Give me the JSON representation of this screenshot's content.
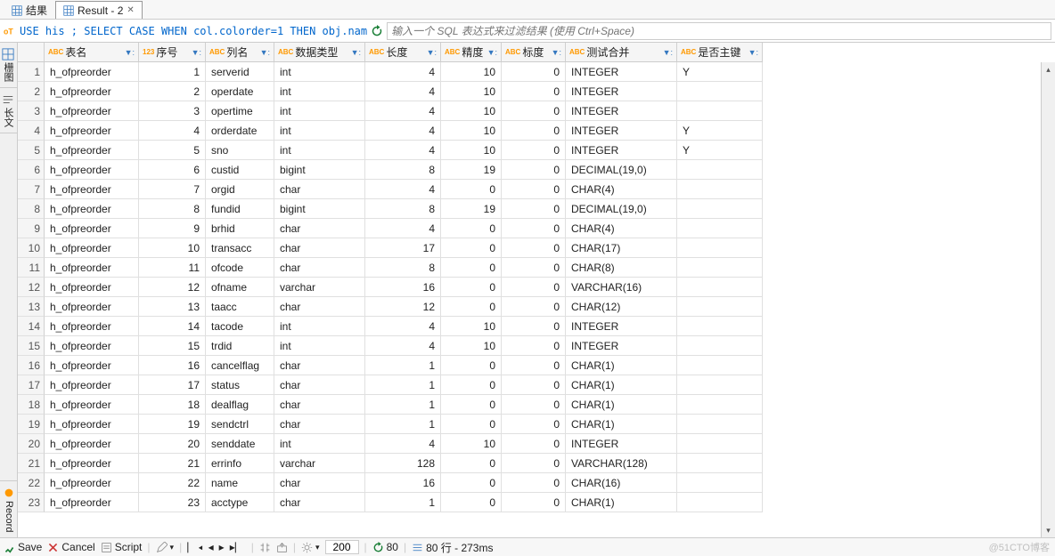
{
  "tabs": {
    "result_cn": "结果",
    "result_en": "Result - 2"
  },
  "toolbar": {
    "sql": "USE his ; SELECT CASE WHEN col.colorder=1 THEN obj.nam",
    "filter_placeholder": "输入一个 SQL 表达式来过滤结果 (使用 Ctrl+Space)"
  },
  "sidetabs": {
    "grid": "栅图",
    "text": "长文"
  },
  "headers": {
    "table": "表名",
    "ord": "序号",
    "col": "列名",
    "dtype": "数据类型",
    "len": "长度",
    "prec": "精度",
    "scale": "标度",
    "test": "测试合并",
    "pk": "是否主键"
  },
  "chart_data": {
    "type": "table",
    "columns": [
      "表名",
      "序号",
      "列名",
      "数据类型",
      "长度",
      "精度",
      "标度",
      "测试合并",
      "是否主键"
    ],
    "rows": [
      [
        "h_ofpreorder",
        1,
        "serverid",
        "int",
        4,
        10,
        0,
        "INTEGER",
        "Y"
      ],
      [
        "h_ofpreorder",
        2,
        "operdate",
        "int",
        4,
        10,
        0,
        "INTEGER",
        ""
      ],
      [
        "h_ofpreorder",
        3,
        "opertime",
        "int",
        4,
        10,
        0,
        "INTEGER",
        ""
      ],
      [
        "h_ofpreorder",
        4,
        "orderdate",
        "int",
        4,
        10,
        0,
        "INTEGER",
        "Y"
      ],
      [
        "h_ofpreorder",
        5,
        "sno",
        "int",
        4,
        10,
        0,
        "INTEGER",
        "Y"
      ],
      [
        "h_ofpreorder",
        6,
        "custid",
        "bigint",
        8,
        19,
        0,
        "DECIMAL(19,0)",
        ""
      ],
      [
        "h_ofpreorder",
        7,
        "orgid",
        "char",
        4,
        0,
        0,
        "CHAR(4)",
        ""
      ],
      [
        "h_ofpreorder",
        8,
        "fundid",
        "bigint",
        8,
        19,
        0,
        "DECIMAL(19,0)",
        ""
      ],
      [
        "h_ofpreorder",
        9,
        "brhid",
        "char",
        4,
        0,
        0,
        "CHAR(4)",
        ""
      ],
      [
        "h_ofpreorder",
        10,
        "transacc",
        "char",
        17,
        0,
        0,
        "CHAR(17)",
        ""
      ],
      [
        "h_ofpreorder",
        11,
        "ofcode",
        "char",
        8,
        0,
        0,
        "CHAR(8)",
        ""
      ],
      [
        "h_ofpreorder",
        12,
        "ofname",
        "varchar",
        16,
        0,
        0,
        "VARCHAR(16)",
        ""
      ],
      [
        "h_ofpreorder",
        13,
        "taacc",
        "char",
        12,
        0,
        0,
        "CHAR(12)",
        ""
      ],
      [
        "h_ofpreorder",
        14,
        "tacode",
        "int",
        4,
        10,
        0,
        "INTEGER",
        ""
      ],
      [
        "h_ofpreorder",
        15,
        "trdid",
        "int",
        4,
        10,
        0,
        "INTEGER",
        ""
      ],
      [
        "h_ofpreorder",
        16,
        "cancelflag",
        "char",
        1,
        0,
        0,
        "CHAR(1)",
        ""
      ],
      [
        "h_ofpreorder",
        17,
        "status",
        "char",
        1,
        0,
        0,
        "CHAR(1)",
        ""
      ],
      [
        "h_ofpreorder",
        18,
        "dealflag",
        "char",
        1,
        0,
        0,
        "CHAR(1)",
        ""
      ],
      [
        "h_ofpreorder",
        19,
        "sendctrl",
        "char",
        1,
        0,
        0,
        "CHAR(1)",
        ""
      ],
      [
        "h_ofpreorder",
        20,
        "senddate",
        "int",
        4,
        10,
        0,
        "INTEGER",
        ""
      ],
      [
        "h_ofpreorder",
        21,
        "errinfo",
        "varchar",
        128,
        0,
        0,
        "VARCHAR(128)",
        ""
      ],
      [
        "h_ofpreorder",
        22,
        "name",
        "char",
        16,
        0,
        0,
        "CHAR(16)",
        ""
      ],
      [
        "h_ofpreorder",
        23,
        "acctype",
        "char",
        1,
        0,
        0,
        "CHAR(1)",
        ""
      ]
    ]
  },
  "statusbar": {
    "save": "Save",
    "cancel": "Cancel",
    "script": "Script",
    "page_size": "200",
    "refresh_count": "80",
    "rows_time": "80 行 - 273ms",
    "record": "Record"
  },
  "corner": "@51CTO博客"
}
